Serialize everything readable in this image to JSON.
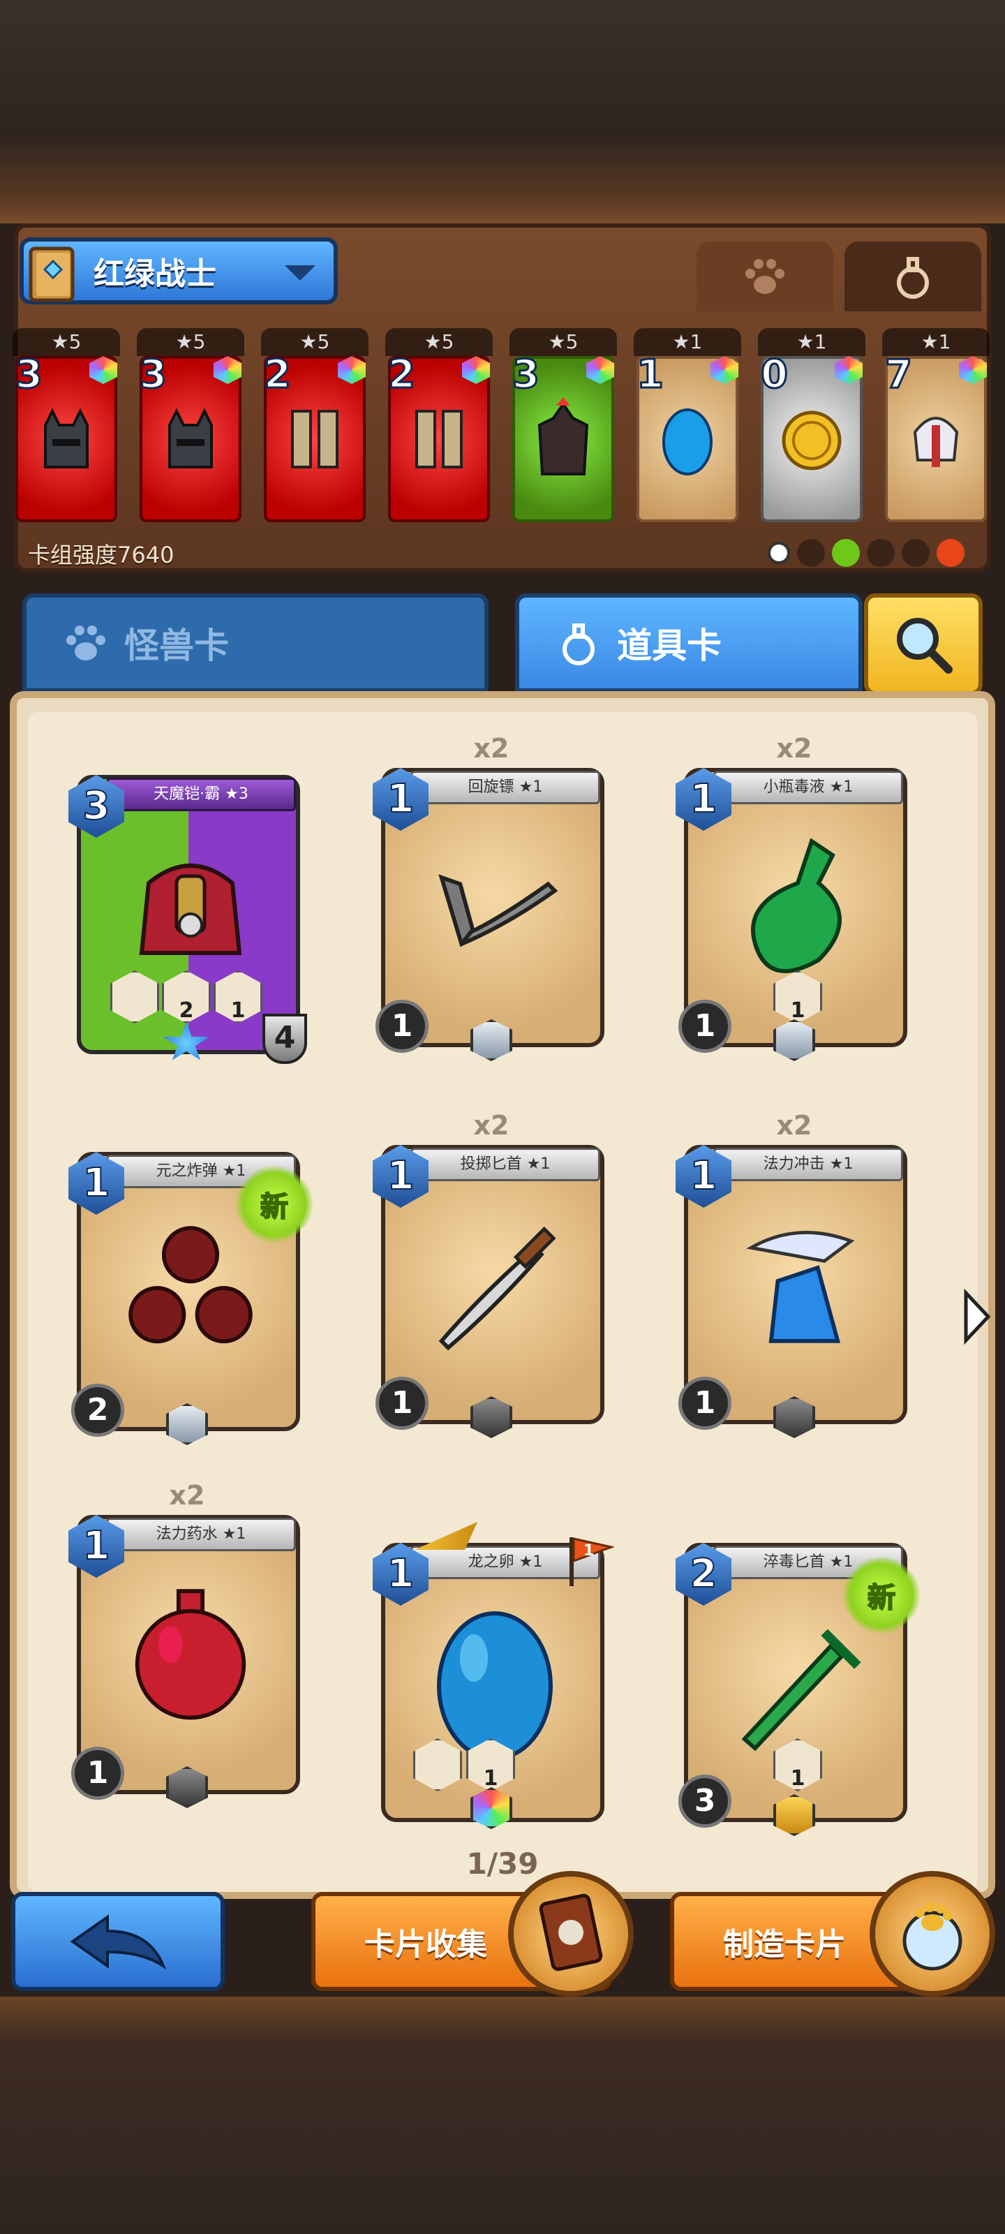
{
  "deck": {
    "name": "红绿战士",
    "power_label": "卡组强度7640",
    "cards": [
      {
        "count": "3",
        "stars": "★5",
        "color": "red",
        "icon": "horned-helmet-icon"
      },
      {
        "count": "3",
        "stars": "★5",
        "color": "red",
        "icon": "horned-helmet-icon"
      },
      {
        "count": "2",
        "stars": "★5",
        "color": "red",
        "icon": "armored-boots-icon"
      },
      {
        "count": "2",
        "stars": "★5",
        "color": "red",
        "icon": "armored-boots-icon"
      },
      {
        "count": "3",
        "stars": "★5",
        "color": "green",
        "icon": "dark-armor-icon"
      },
      {
        "count": "1",
        "stars": "★1",
        "color": "tan",
        "icon": "blue-egg-icon"
      },
      {
        "count": "0",
        "stars": "★1",
        "color": "grey",
        "icon": "gold-coin-icon"
      },
      {
        "count": "7",
        "stars": "★1",
        "color": "tan",
        "icon": "winged-helmet-icon"
      }
    ]
  },
  "tabs": {
    "monster": "怪兽卡",
    "item": "道具卡"
  },
  "cards": [
    {
      "name": "天魔铠·霸 ★3",
      "mana": "3",
      "copies": "",
      "cost": "",
      "rarity": "",
      "new": false,
      "icon": "demon-armor-icon",
      "special": "armor",
      "armor_val": "4",
      "gem1": "2",
      "gem2": "1"
    },
    {
      "name": "回旋镖 ★1",
      "mana": "1",
      "copies": "x2",
      "cost": "1",
      "rarity": "silver",
      "new": false,
      "icon": "boomerang-icon"
    },
    {
      "name": "小瓶毒液 ★1",
      "mana": "1",
      "copies": "x2",
      "cost": "1",
      "rarity": "silver",
      "new": false,
      "icon": "poison-bottle-icon",
      "gem": "1"
    },
    {
      "name": "元之炸弹 ★1",
      "mana": "1",
      "copies": "",
      "cost": "2",
      "rarity": "silver",
      "new": true,
      "icon": "bombs-icon"
    },
    {
      "name": "投掷匕首 ★1",
      "mana": "1",
      "copies": "x2",
      "cost": "1",
      "rarity": "dark",
      "new": false,
      "icon": "dagger-icon"
    },
    {
      "name": "法力冲击 ★1",
      "mana": "1",
      "copies": "x2",
      "cost": "1",
      "rarity": "dark",
      "new": false,
      "icon": "mana-strike-icon"
    },
    {
      "name": "法力药水 ★1",
      "mana": "1",
      "copies": "x2",
      "cost": "1",
      "rarity": "dark",
      "new": false,
      "icon": "red-potion-icon"
    },
    {
      "name": "龙之卵 ★1",
      "mana": "1",
      "copies": "",
      "cost": "",
      "rarity": "rainbow",
      "new": false,
      "icon": "dragon-egg-icon",
      "gem": "1",
      "flag": "1"
    },
    {
      "name": "淬毒匕首 ★1",
      "mana": "2",
      "copies": "",
      "cost": "3",
      "rarity": "gold",
      "new": true,
      "icon": "poison-dagger-icon",
      "gem": "1"
    }
  ],
  "new_label": "新",
  "page": "1/39",
  "buttons": {
    "collect": "卡片收集",
    "craft": "制造卡片"
  },
  "colors": {
    "accent_blue": "#3a88e5",
    "accent_orange": "#e9720e",
    "new_green": "#8ed320"
  }
}
